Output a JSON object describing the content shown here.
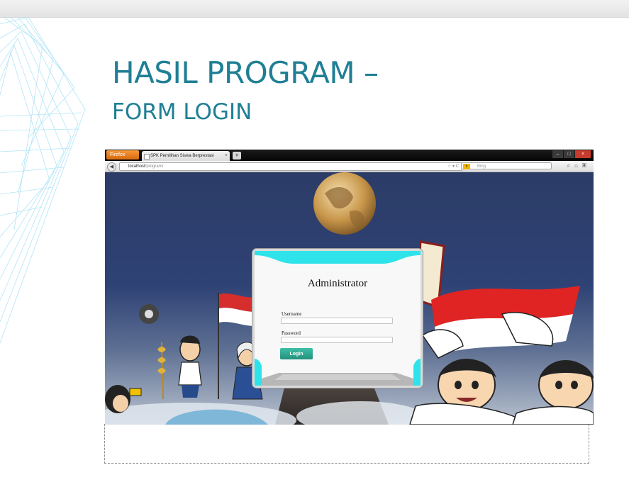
{
  "slide": {
    "title": "HASIL PROGRAM –",
    "subtitle": "FORM LOGIN"
  },
  "browser": {
    "app_button": "Firefox",
    "tab_title": "SPK Pemilihan Siswa Berprestasi",
    "url_host": "localhost",
    "url_path": "/program/",
    "search_placeholder": "Bing"
  },
  "login": {
    "title": "Administrator",
    "username_label": "Username",
    "username_value": "",
    "password_label": "Password",
    "password_value": "",
    "button_label": "Login"
  },
  "colors": {
    "title": "#1f7f94",
    "panel_accent": "#2fe3ea",
    "login_button": "#2aa58d",
    "page_sky": "#2c3c67"
  }
}
